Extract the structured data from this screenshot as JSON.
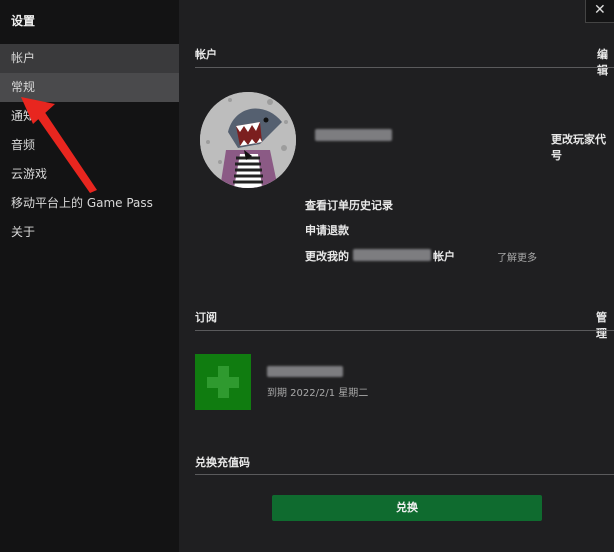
{
  "sidebar": {
    "title": "设置",
    "items": [
      {
        "label": "帐户"
      },
      {
        "label": "常规"
      },
      {
        "label": "通知"
      },
      {
        "label": "音频"
      },
      {
        "label": "云游戏"
      },
      {
        "label": "移动平台上的 Game Pass"
      },
      {
        "label": "关于"
      }
    ]
  },
  "account": {
    "heading": "帐户",
    "edit_label": "编辑",
    "change_gamertag": "更改玩家代号",
    "order_history": "查看订单历史记录",
    "refund": "申请退款",
    "change_account_prefix": "更改我的",
    "change_account_suffix": "帐户",
    "learn_more": "了解更多"
  },
  "subscription": {
    "heading": "订阅",
    "manage_label": "管理",
    "expiry": "到期 2022/2/1 星期二"
  },
  "redeem": {
    "heading": "兑换充值码",
    "button_label": "兑换"
  },
  "window": {
    "close_glyph": "✕"
  },
  "colors": {
    "accent_green": "#107c10",
    "button_green": "#0f6b2f",
    "arrow_red": "#e8261f"
  }
}
